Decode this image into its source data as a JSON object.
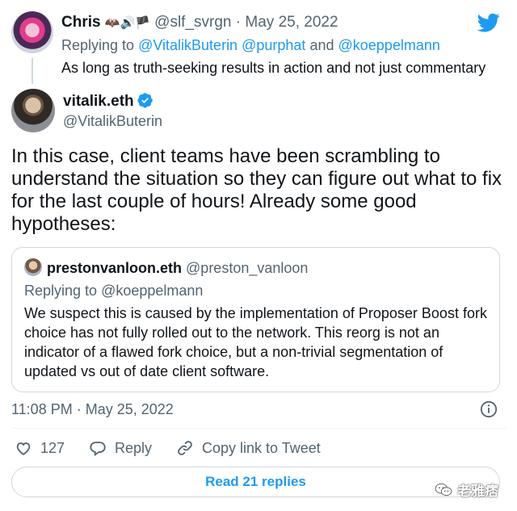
{
  "reply_tweet": {
    "display_name": "Chris",
    "name_emoji": "🦇🔊🏴",
    "handle": "@slf_svrgn",
    "separator": "·",
    "date": "May 25, 2022",
    "replying_prefix": "Replying to",
    "replying_handles": [
      "@VitalikButerin",
      "@purphat",
      "@koeppelmann"
    ],
    "replying_and": "and",
    "text": "As long as truth-seeking results in action and not just commentary"
  },
  "main_tweet": {
    "display_name": "vitalik.eth",
    "handle": "@VitalikButerin",
    "text": "In this case, client teams have been scrambling to understand the situation so they can figure out what to fix for the last couple of hours! Already some good hypotheses:",
    "timestamp": "11:08 PM · May 25, 2022"
  },
  "quoted_tweet": {
    "display_name": "prestonvanloon.eth",
    "handle": "@preston_vanloon",
    "replying_prefix": "Replying to",
    "replying_handle": "@koeppelmann",
    "text": "We suspect this is caused by the implementation of Proposer Boost fork choice has not fully rolled out to the network. This reorg is not an indicator of a flawed fork choice, but a non-trivial segmentation of updated vs out of date client software."
  },
  "actions": {
    "like_count": "127",
    "reply_label": "Reply",
    "copy_label": "Copy link to Tweet"
  },
  "read_replies_label": "Read 21 replies",
  "watermark_text": "老雅痞",
  "colors": {
    "accent": "#1d9bf0",
    "text": "#0f1419",
    "muted": "#536471",
    "border": "#cfd9de"
  },
  "icons": [
    "twitter-bird-icon",
    "verified-badge-icon",
    "info-icon",
    "heart-icon",
    "reply-icon",
    "link-icon",
    "wechat-icon"
  ]
}
